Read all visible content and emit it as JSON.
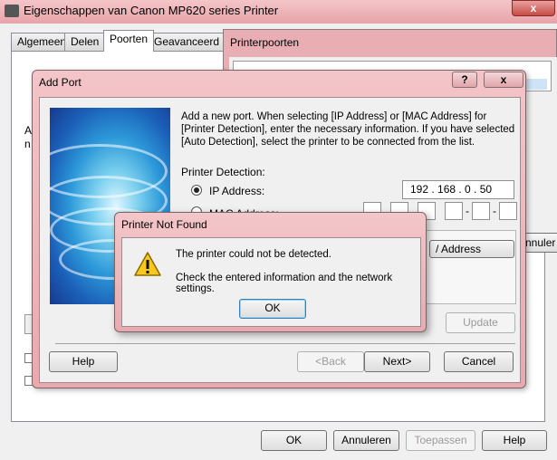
{
  "main_window": {
    "title": "Eigenschappen van Canon MP620 series Printer",
    "close_glyph": "x",
    "tabs": [
      "Algemeen",
      "Delen",
      "Poorten",
      "Geavanceerd"
    ],
    "buttons": {
      "ok": "OK",
      "cancel": "Annuleren",
      "apply": "Toepassen",
      "help": "Help"
    },
    "partial_texts": {
      "left_a": "A",
      "left_n": "n"
    }
  },
  "ports_window": {
    "title": "Printerpoorten",
    "partial_button": "nnuler"
  },
  "add_port": {
    "title": "Add Port",
    "help_glyph": "?",
    "close_glyph": "x",
    "intro": "Add a new port. When selecting [IP Address] or [MAC Address] for [Printer Detection], enter the necessary information. If you have selected [Auto Detection], select the printer to be connected from the list.",
    "detection_label": "Printer Detection:",
    "ip_label": "IP Address:",
    "ip_value": "192 . 168 .  0  .  50",
    "mac_label": "MAC Address:",
    "mac_separator": "-",
    "address_button_partial": "/ Address",
    "update_button": "Update",
    "buttons": {
      "help": "Help",
      "back": "<Back",
      "next": "Next>",
      "cancel": "Cancel"
    }
  },
  "not_found": {
    "title": "Printer Not Found",
    "line1": "The printer could not be detected.",
    "line2": "Check the entered information and the network settings.",
    "ok": "OK",
    "icon": "warning-triangle-icon"
  },
  "colors": {
    "title_bar": "#e9a9ae",
    "dialog_bg": "#f0f0f0",
    "banner": "#2c98d8"
  }
}
